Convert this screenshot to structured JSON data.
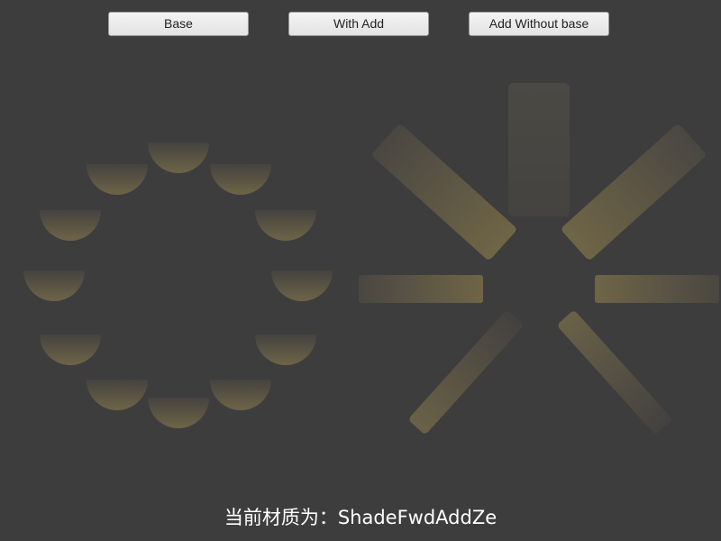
{
  "buttons": {
    "base": "Base",
    "with_add": "With Add",
    "add_without_base": "Add Without base"
  },
  "status": {
    "text": "当前材质为：ShadeFwdAddZe"
  },
  "colors": {
    "background": "#3d3d3d",
    "shape_lit": "#6b6147",
    "shape_dark": "#4a4640",
    "text": "#ffffff"
  }
}
